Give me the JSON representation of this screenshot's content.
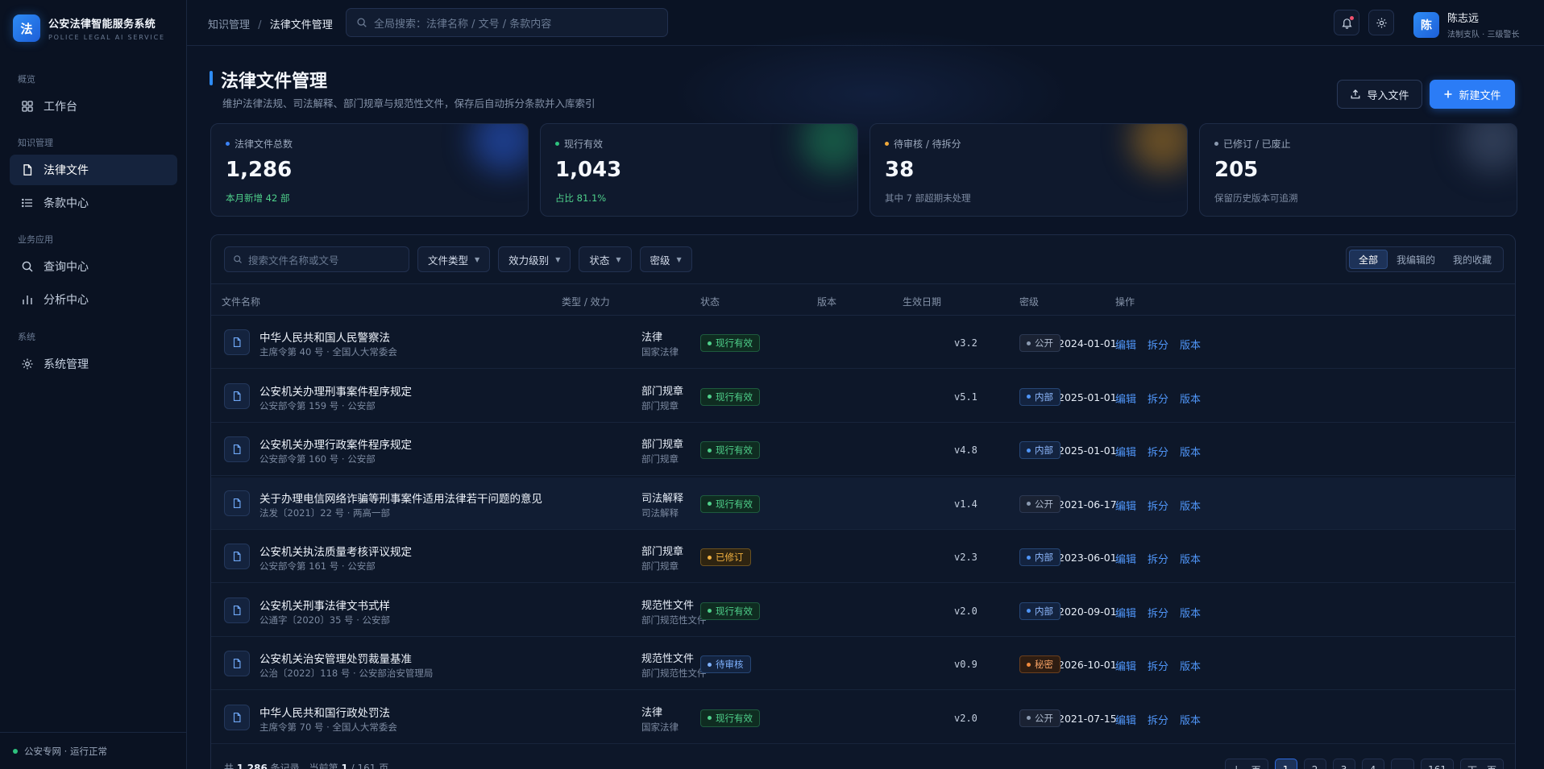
{
  "brand": {
    "logo_char": "法",
    "title": "公安法律智能服务系统",
    "subtitle": "POLICE LEGAL AI SERVICE"
  },
  "sidebar": {
    "groups": [
      "概览",
      "知识管理",
      "业务应用",
      "系统"
    ],
    "items": [
      {
        "label": "工作台",
        "icon": "dashboard-icon",
        "active": false
      },
      {
        "label": "法律文件",
        "icon": "document-icon",
        "active": true
      },
      {
        "label": "条款中心",
        "icon": "list-icon",
        "active": false
      },
      {
        "label": "查询中心",
        "icon": "search-icon",
        "active": false
      },
      {
        "label": "分析中心",
        "icon": "bar-chart-icon",
        "active": false
      },
      {
        "label": "系统管理",
        "icon": "gear-icon",
        "active": false
      }
    ],
    "network_status": "公安专网 · 运行正常",
    "status_color": "#2ec27e"
  },
  "topbar": {
    "breadcrumb": [
      "知识管理",
      "法律文件管理"
    ],
    "search_placeholder": "全局搜索：法律名称 / 文号 / 条款内容",
    "user_avatar_char": "陈",
    "user_name": "陈志远",
    "user_role": "法制支队 · 三级警长"
  },
  "page": {
    "title": "法律文件管理",
    "subtitle": "维护法律法规、司法解释、部门规章与规范性文件，保存后自动拆分条款并入库索引",
    "import_label": "导入文件",
    "new_label": "新建文件"
  },
  "stats": [
    {
      "label": "法律文件总数",
      "value": "1,286",
      "foot": "本月新增 42 部",
      "dot": "#3b82f6",
      "foot_color": "#4fd18b"
    },
    {
      "label": "现行有效",
      "value": "1,043",
      "foot": "占比 81.1%",
      "dot": "#2ec27e",
      "foot_color": "#4fd18b"
    },
    {
      "label": "待审核 / 待拆分",
      "value": "38",
      "foot": "其中 7 部超期未处理",
      "dot": "#f0a93b",
      "foot_color": "#7c8aa1"
    },
    {
      "label": "已修订 / 已废止",
      "value": "205",
      "foot": "保留历史版本可追溯",
      "dot": "#8b9ab0",
      "foot_color": "#7c8aa1"
    }
  ],
  "filters": {
    "search_placeholder": "搜索文件名称或文号",
    "dropdowns": [
      "文件类型",
      "效力级别",
      "状态",
      "密级"
    ],
    "tabs": [
      "全部",
      "我编辑的",
      "我的收藏"
    ],
    "active_tab": 0
  },
  "table": {
    "headers": [
      "文件名称",
      "类型 / 效力",
      "状态",
      "版本",
      "生效日期",
      "密级",
      "操作"
    ],
    "actions": [
      "编辑",
      "拆分",
      "版本"
    ],
    "rows": [
      {
        "name": "中华人民共和国人民警察法",
        "meta": "主席令第 40 号 · 全国人大常委会",
        "type": "法律",
        "power": "国家法律",
        "status": "现行有效",
        "status_kind": "active",
        "version": "v3.2",
        "date": "2024-01-01",
        "level": "公开",
        "level_kind": "public"
      },
      {
        "name": "公安机关办理刑事案件程序规定",
        "meta": "公安部令第 159 号 · 公安部",
        "type": "部门规章",
        "power": "部门规章",
        "status": "现行有效",
        "status_kind": "active",
        "version": "v5.1",
        "date": "2025-01-01",
        "level": "内部",
        "level_kind": "internal"
      },
      {
        "name": "公安机关办理行政案件程序规定",
        "meta": "公安部令第 160 号 · 公安部",
        "type": "部门规章",
        "power": "部门规章",
        "status": "现行有效",
        "status_kind": "active",
        "version": "v4.8",
        "date": "2025-01-01",
        "level": "内部",
        "level_kind": "internal"
      },
      {
        "name": "关于办理电信网络诈骗等刑事案件适用法律若干问题的意见",
        "meta": "法发〔2021〕22 号 · 两高一部",
        "type": "司法解释",
        "power": "司法解释",
        "status": "现行有效",
        "status_kind": "active",
        "version": "v1.4",
        "date": "2021-06-17",
        "level": "公开",
        "level_kind": "public"
      },
      {
        "name": "公安机关执法质量考核评议规定",
        "meta": "公安部令第 161 号 · 公安部",
        "type": "部门规章",
        "power": "部门规章",
        "status": "已修订",
        "status_kind": "revised",
        "version": "v2.3",
        "date": "2023-06-01",
        "level": "内部",
        "level_kind": "internal"
      },
      {
        "name": "公安机关刑事法律文书式样",
        "meta": "公通字〔2020〕35 号 · 公安部",
        "type": "规范性文件",
        "power": "部门规范性文件",
        "status": "现行有效",
        "status_kind": "active",
        "version": "v2.0",
        "date": "2020-09-01",
        "level": "内部",
        "level_kind": "internal"
      },
      {
        "name": "公安机关治安管理处罚裁量基准",
        "meta": "公治〔2022〕118 号 · 公安部治安管理局",
        "type": "规范性文件",
        "power": "部门规范性文件",
        "status": "待审核",
        "status_kind": "pending",
        "version": "v0.9",
        "date": "2026-10-01",
        "level": "秘密",
        "level_kind": "secret"
      },
      {
        "name": "中华人民共和国行政处罚法",
        "meta": "主席令第 70 号 · 全国人大常委会",
        "type": "法律",
        "power": "国家法律",
        "status": "现行有效",
        "status_kind": "active",
        "version": "v2.0",
        "date": "2021-07-15",
        "level": "公开",
        "level_kind": "public"
      }
    ]
  },
  "pagination": {
    "prefix": "共",
    "total": "1,286",
    "mid": "条记录，当前第",
    "current": "1",
    "suffix": "/ 161 页",
    "prev_label": "上一页",
    "next_label": "下一页",
    "pages": [
      "1",
      "2",
      "3",
      "4",
      "...",
      "161"
    ]
  }
}
